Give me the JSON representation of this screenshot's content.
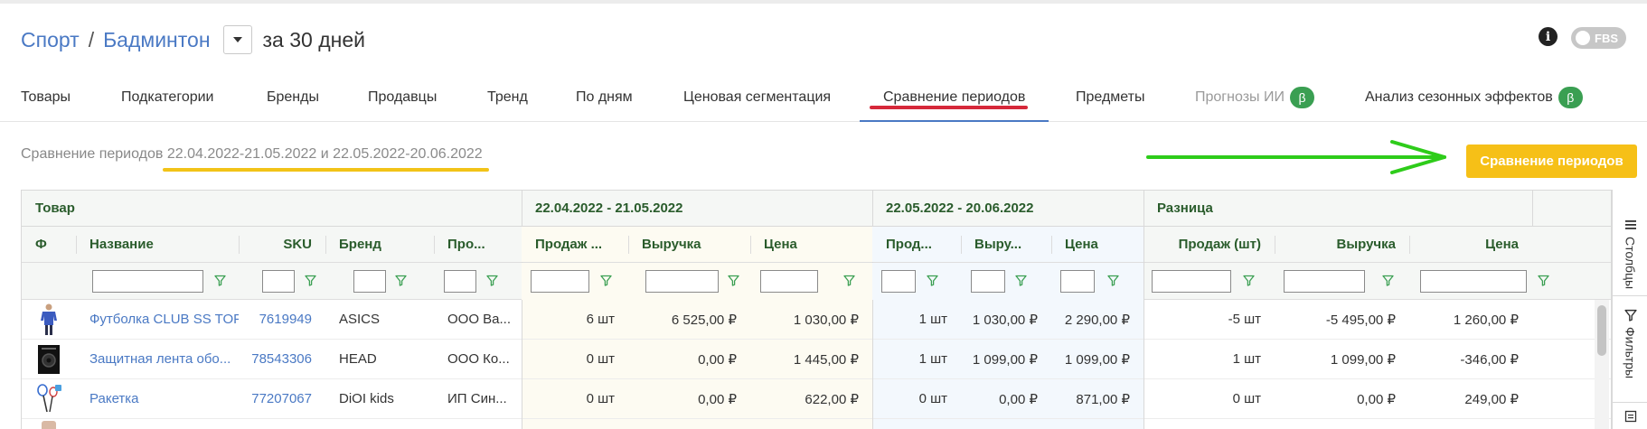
{
  "header": {
    "crumb_category": "Спорт",
    "crumb_separator": "/",
    "crumb_subcategory": "Бадминтон",
    "period_label": "за 30 дней",
    "fbs_label": "FBS",
    "info_glyph": "i"
  },
  "tabs": [
    {
      "label": "Товары"
    },
    {
      "label": "Подкатегории"
    },
    {
      "label": "Бренды"
    },
    {
      "label": "Продавцы"
    },
    {
      "label": "Тренд"
    },
    {
      "label": "По дням"
    },
    {
      "label": "Ценовая сегментация"
    },
    {
      "label": "Сравнение периодов",
      "active": true
    },
    {
      "label": "Предметы"
    },
    {
      "label": "Прогнозы ИИ",
      "beta": "β"
    },
    {
      "label": "Анализ сезонных эффектов",
      "beta": "β"
    }
  ],
  "subtitle": {
    "prefix": "Сравнение периодов",
    "period1": "22.04.2022-21.05.2022",
    "conjunction": "и",
    "period2": "22.05.2022-20.06.2022"
  },
  "compare_button": "Сравнение периодов",
  "grid": {
    "groups": [
      "Товар",
      "22.04.2022 - 21.05.2022",
      "22.05.2022 - 20.06.2022",
      "Разница"
    ],
    "columns": [
      "Ф",
      "Название",
      "SKU",
      "Бренд",
      "Про...",
      "Продаж ...",
      "Выручка",
      "Цена",
      "Прод...",
      "Выру...",
      "Цена",
      "Продаж (шт)",
      "Выручка",
      "Цена"
    ],
    "rows": [
      {
        "name": "Футболка CLUB SS TOP",
        "sku": "7619949",
        "brand": "ASICS",
        "seller": "ООО Ва...",
        "p1_sales": "6 шт",
        "p1_revenue": "6 525,00 ₽",
        "p1_price": "1 030,00 ₽",
        "p2_sales": "1 шт",
        "p2_revenue": "1 030,00 ₽",
        "p2_price": "2 290,00 ₽",
        "d_sales": "-5 шт",
        "d_revenue": "-5 495,00 ₽",
        "d_price": "1 260,00 ₽"
      },
      {
        "name": "Защитная лента обо...",
        "sku": "78543306",
        "brand": "HEAD",
        "seller": "ООО Ко...",
        "p1_sales": "0 шт",
        "p1_revenue": "0,00 ₽",
        "p1_price": "1 445,00 ₽",
        "p2_sales": "1 шт",
        "p2_revenue": "1 099,00 ₽",
        "p2_price": "1 099,00 ₽",
        "d_sales": "1 шт",
        "d_revenue": "1 099,00 ₽",
        "d_price": "-346,00 ₽"
      },
      {
        "name": "Ракетка",
        "sku": "77207067",
        "brand": "DiOI kids",
        "seller": "ИП Син...",
        "p1_sales": "0 шт",
        "p1_revenue": "0,00 ₽",
        "p1_price": "622,00 ₽",
        "p2_sales": "0 шт",
        "p2_revenue": "0,00 ₽",
        "p2_price": "871,00 ₽",
        "d_sales": "0 шт",
        "d_revenue": "0,00 ₽",
        "d_price": "249,00 ₽"
      }
    ]
  },
  "side_panel": {
    "columns_label": "Столбцы",
    "filters_label": "Фильтры"
  },
  "colors": {
    "link": "#4a79c4",
    "header_green": "#2a5c2c",
    "accent_yellow": "#f6c017",
    "beta_green": "#3a9f52",
    "annotation_red": "#d6283a",
    "annotation_green": "#2ecc1a"
  }
}
